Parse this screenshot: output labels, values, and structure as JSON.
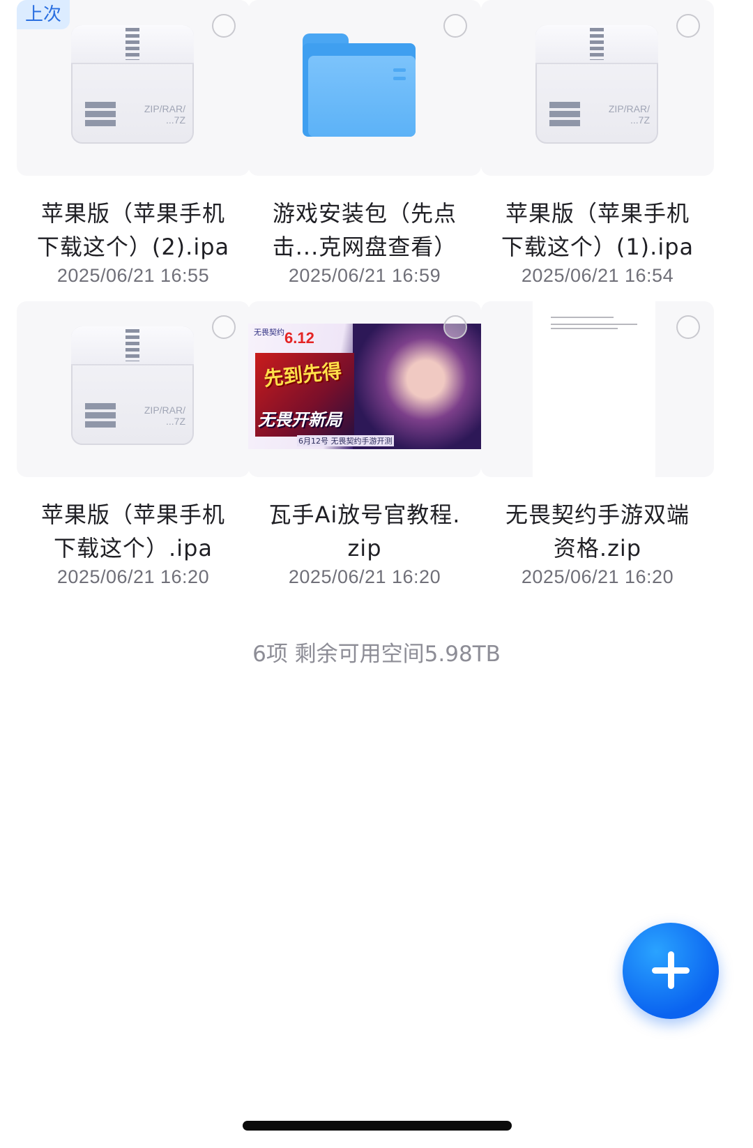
{
  "files": [
    {
      "kind": "zip",
      "badge": "上次",
      "name_line1": "苹果版（苹果手机",
      "name_line2": "下载这个）(2).ipa",
      "date": "2025/06/21 16:55",
      "icon_label_line1": "ZIP/RAR/",
      "icon_label_line2": "...7Z"
    },
    {
      "kind": "folder",
      "name_line1": "游戏安装包（先点",
      "name_line2": "击...克网盘查看）",
      "date": "2025/06/21 16:59"
    },
    {
      "kind": "zip",
      "name_line1": "苹果版（苹果手机",
      "name_line2": "下载这个）(1).ipa",
      "date": "2025/06/21 16:54",
      "icon_label_line1": "ZIP/RAR/",
      "icon_label_line2": "...7Z"
    },
    {
      "kind": "zip",
      "name_line1": "苹果版（苹果手机",
      "name_line2": "下载这个）.ipa",
      "date": "2025/06/21 16:20",
      "icon_label_line1": "ZIP/RAR/",
      "icon_label_line2": "...7Z"
    },
    {
      "kind": "image",
      "name_line1": "瓦手Ai放号官教程.",
      "name_line2": "zip",
      "date": "2025/06/21 16:20",
      "thumb_brand": "无畏契约",
      "thumb_date": "6.12",
      "thumb_text1": "先到先得",
      "thumb_text2": "无畏开新局",
      "thumb_caption": "6月12号 无畏契约手游开测"
    },
    {
      "kind": "document",
      "name_line1": "无畏契约手游双端",
      "name_line2": "资格.zip",
      "date": "2025/06/21 16:20"
    }
  ],
  "footer": {
    "summary": "6项 剩余可用空间5.98TB"
  },
  "fab": {
    "icon": "plus-icon"
  },
  "colors": {
    "accent": "#0a63f0",
    "badge_bg": "#dcecff",
    "badge_text": "#2a6fe0",
    "folder": "#5cb2f7"
  }
}
